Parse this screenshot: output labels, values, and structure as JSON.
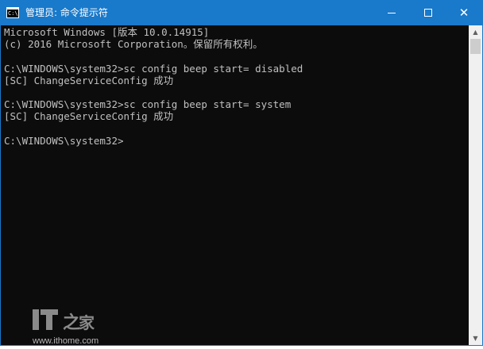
{
  "window": {
    "title": "管理员: 命令提示符",
    "icon_label": "C:\\",
    "titlebar_color": "#1979ca",
    "controls": {
      "minimize_icon": "minimize-icon",
      "maximize_icon": "maximize-icon",
      "close_icon": "close-icon",
      "close_glyph": "✕"
    }
  },
  "console": {
    "background": "#0c0c0c",
    "foreground": "#c0c0c0",
    "lines": [
      "Microsoft Windows [版本 10.0.14915]",
      "(c) 2016 Microsoft Corporation。保留所有权利。",
      "",
      "C:\\WINDOWS\\system32>sc config beep start= disabled",
      "[SC] ChangeServiceConfig 成功",
      "",
      "C:\\WINDOWS\\system32>sc config beep start= system",
      "[SC] ChangeServiceConfig 成功",
      "",
      "C:\\WINDOWS\\system32>"
    ]
  },
  "scrollbar": {
    "up_glyph": "▲",
    "down_glyph": "▼"
  },
  "watermark": {
    "logo": "IT之家",
    "url": "www.ithome.com"
  }
}
